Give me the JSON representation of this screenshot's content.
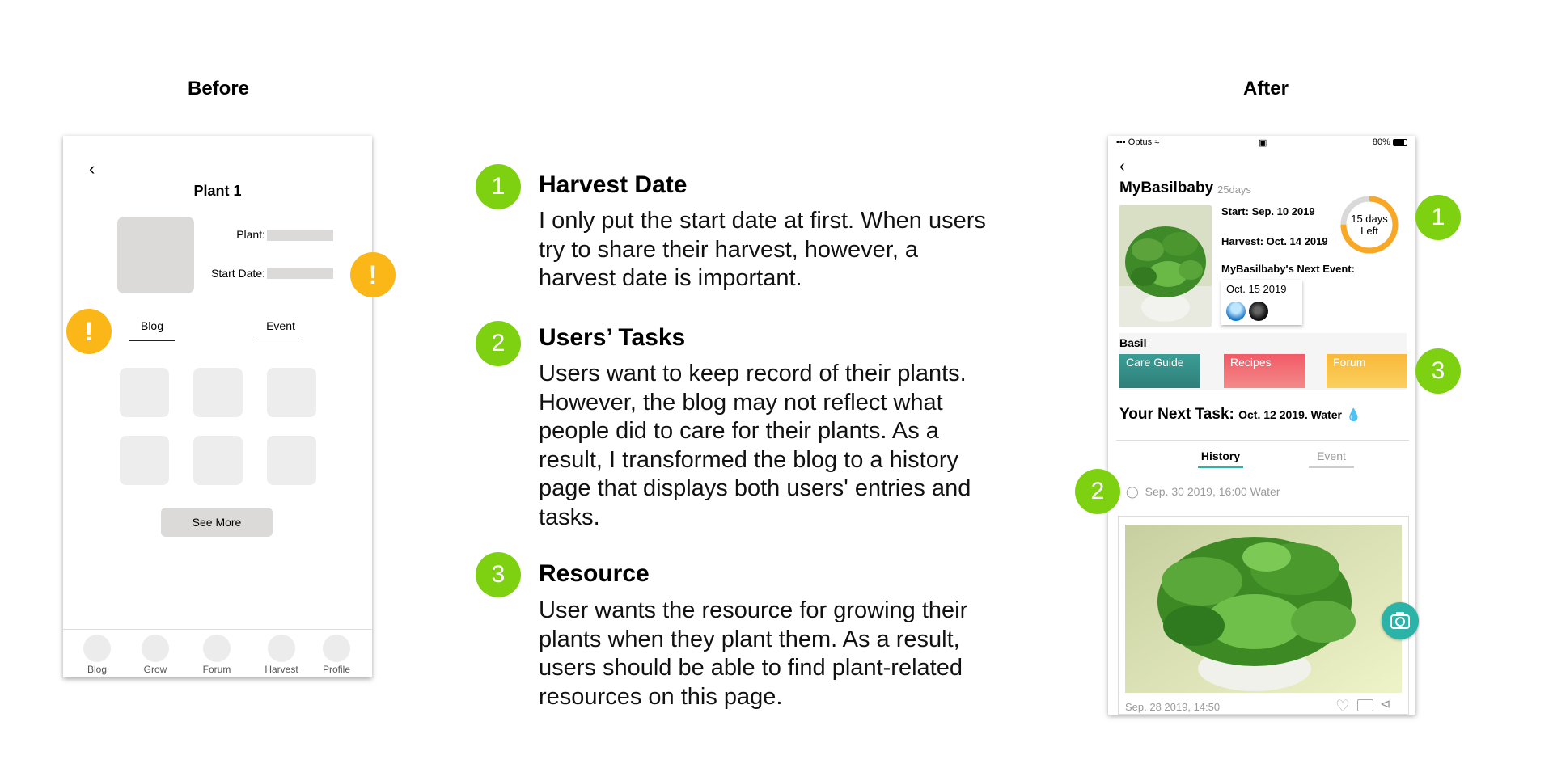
{
  "headings": {
    "before": "Before",
    "after": "After"
  },
  "before": {
    "back_icon": "chevron-left-icon",
    "title": "Plant 1",
    "plant_label": "Plant:",
    "start_date_label": "Start Date:",
    "tabs": [
      "Blog",
      "Event"
    ],
    "see_more": "See More",
    "nav": [
      "Blog",
      "Grow",
      "Forum",
      "Harvest",
      "Profile"
    ],
    "warn_mark": "!",
    "colors": {
      "warning": "#fbb617",
      "placeholder": "#dcd9d9"
    }
  },
  "points": [
    {
      "number": "1",
      "title": "Harvest Date",
      "body": "I only put the start date at first. When users try to share their harvest, however, a harvest date is important."
    },
    {
      "number": "2",
      "title": "Users’ Tasks",
      "body": "Users want to keep record of their plants. However, the blog may not reflect what people did to care for their plants. As a result, I transformed the blog to a history page that displays both users' entries and tasks."
    },
    {
      "number": "3",
      "title": "Resource",
      "body": "User wants the resource for growing their plants when they plant them. As a result, users should be able to find plant-related resources on this page."
    }
  ],
  "after": {
    "status": {
      "carrier": "Optus",
      "battery": "80%"
    },
    "name": "MyBasilbaby",
    "age": "25days",
    "start_label": "Start:",
    "start_value": "Sep. 10 2019",
    "harvest_label": "Harvest:",
    "harvest_value": "Oct. 14 2019",
    "next_event_label": "MyBasilbaby's Next Event:",
    "next_event_date": "Oct. 15 2019",
    "days_left": "15 days",
    "left_label": "Left",
    "days_left_progress": 0.75,
    "category": "Basil",
    "resources": [
      {
        "label": "Care Guide",
        "color": "#3a9e96"
      },
      {
        "label": "Recipes",
        "color": "#f25a66"
      },
      {
        "label": "Forum",
        "color": "#f9b93a"
      }
    ],
    "next_task_label": "Your Next Task:",
    "next_task_value": "Oct. 12 2019. Water",
    "tabs": [
      "History",
      "Event"
    ],
    "log_entry": "Sep. 30 2019, 16:00  Water",
    "post_date": "Sep. 28 2019, 14:50",
    "colors": {
      "accent": "#2bb3a8",
      "progress": "#f9a825",
      "marker": "#7ed111"
    }
  },
  "markers": [
    "1",
    "2",
    "3"
  ]
}
